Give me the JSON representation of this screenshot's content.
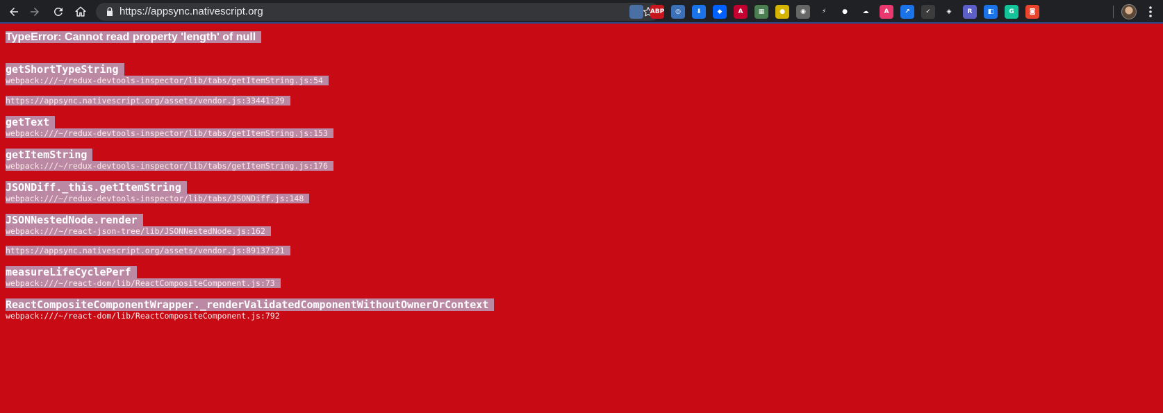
{
  "browser": {
    "url": "https://appsync.nativescript.org",
    "extensions": [
      {
        "name": "extension-icon-1",
        "glyph": "",
        "color": "#4a6fa5"
      },
      {
        "name": "adblock-plus-icon",
        "glyph": "ABP",
        "color": "#c5161d"
      },
      {
        "name": "extension-icon-3",
        "glyph": "◎",
        "color": "#3b6fb6"
      },
      {
        "name": "download-icon",
        "glyph": "⬇",
        "color": "#1a73e8"
      },
      {
        "name": "dropbox-icon",
        "glyph": "◆",
        "color": "#0061fe"
      },
      {
        "name": "angular-icon",
        "glyph": "A",
        "color": "#c3002f"
      },
      {
        "name": "extension-icon-7",
        "glyph": "▦",
        "color": "#4b7f52"
      },
      {
        "name": "extension-icon-8",
        "glyph": "●",
        "color": "#d4b400"
      },
      {
        "name": "extension-icon-9",
        "glyph": "◉",
        "color": "#666666"
      },
      {
        "name": "bolt-icon",
        "glyph": "⚡",
        "color": "#202124"
      },
      {
        "name": "record-icon",
        "glyph": "●",
        "color": "#202124"
      },
      {
        "name": "extension-icon-12",
        "glyph": "☁",
        "color": "#202124"
      },
      {
        "name": "extension-icon-13",
        "glyph": "A",
        "color": "#e8386e"
      },
      {
        "name": "extension-icon-14",
        "glyph": "↗",
        "color": "#1a73e8"
      },
      {
        "name": "extension-icon-15",
        "glyph": "✓",
        "color": "#3c3c3c"
      },
      {
        "name": "extension-icon-16",
        "glyph": "◈",
        "color": "#202124"
      },
      {
        "name": "extension-icon-17",
        "glyph": "R",
        "color": "#5b5fc7"
      },
      {
        "name": "extension-icon-18",
        "glyph": "◧",
        "color": "#1a73e8"
      },
      {
        "name": "grammarly-icon",
        "glyph": "G",
        "color": "#15c39a"
      },
      {
        "name": "extension-icon-20",
        "glyph": "◙",
        "color": "#e8452c"
      }
    ]
  },
  "error": {
    "title": "TypeError: Cannot read property 'length' of null",
    "frames": [
      {
        "fn": "getShortTypeString",
        "loc": "webpack:///~/redux-devtools-inspector/lib/tabs/getItemString.js:54"
      },
      {
        "fn": "",
        "loc": "https://appsync.nativescript.org/assets/vendor.js:33441:29"
      },
      {
        "fn": "getText",
        "loc": "webpack:///~/redux-devtools-inspector/lib/tabs/getItemString.js:153"
      },
      {
        "fn": "getItemString",
        "loc": "webpack:///~/redux-devtools-inspector/lib/tabs/getItemString.js:176"
      },
      {
        "fn": "JSONDiff._this.getItemString",
        "loc": "webpack:///~/redux-devtools-inspector/lib/tabs/JSONDiff.js:148"
      },
      {
        "fn": "JSONNestedNode.render",
        "loc": "webpack:///~/react-json-tree/lib/JSONNestedNode.js:162"
      },
      {
        "fn": "",
        "loc": "https://appsync.nativescript.org/assets/vendor.js:89137:21"
      },
      {
        "fn": "measureLifeCyclePerf",
        "loc": "webpack:///~/react-dom/lib/ReactCompositeComponent.js:73"
      },
      {
        "fn": "ReactCompositeComponentWrapper._renderValidatedComponentWithoutOwnerOrContext",
        "loc": "webpack:///~/react-dom/lib/ReactCompositeComponent.js:792"
      }
    ]
  }
}
